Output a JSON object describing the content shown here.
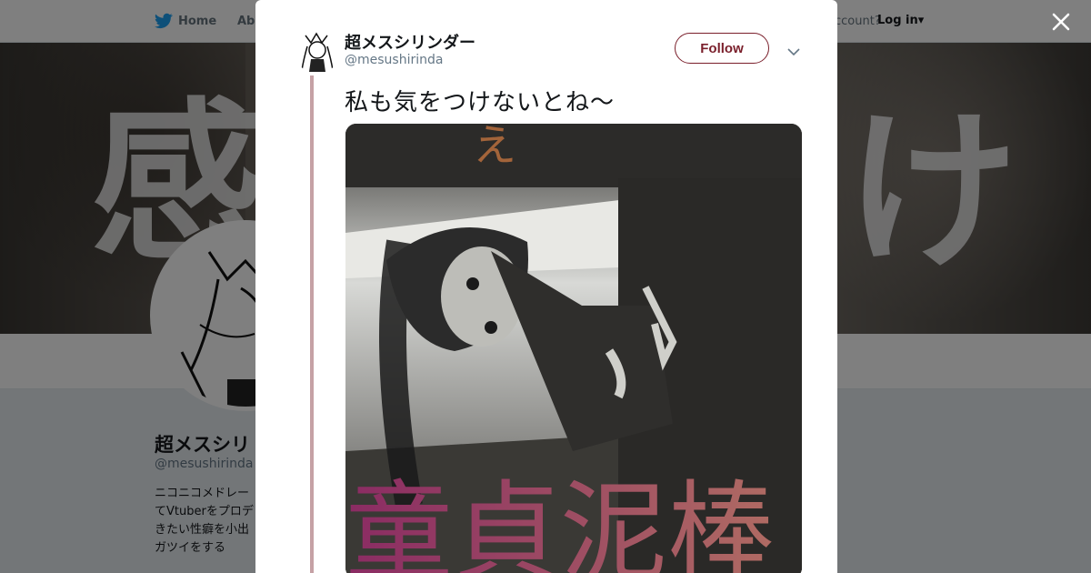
{
  "nav": {
    "home_label": "Home",
    "about_label": "Abo",
    "account_text": "ccount?",
    "login_label": "Log in▾"
  },
  "banner": {
    "left_text": "感",
    "right_text": "け"
  },
  "profile": {
    "name": "超メスシリ",
    "handle": "@mesushirinda",
    "bio_lines": [
      "ニコニコメドレー",
      "てVtuberをプロデ",
      "きたい性癖を小出",
      "ガツイをする"
    ]
  },
  "modal": {
    "author_name": "超メスシリンダー",
    "author_handle": "@mesushirinda",
    "follow_label": "Follow",
    "tweet_text": "私も気をつけないとね～",
    "media_title_text": "童貞泥棒",
    "media_top_text": "え"
  },
  "colors": {
    "accent": "#7a1f2b",
    "thread_line": "#c5a1a5",
    "twitter_blue": "#1da1f2"
  },
  "icons": {
    "home": "twitter-bird-icon",
    "close": "close-icon",
    "caret": "chevron-down-icon"
  }
}
